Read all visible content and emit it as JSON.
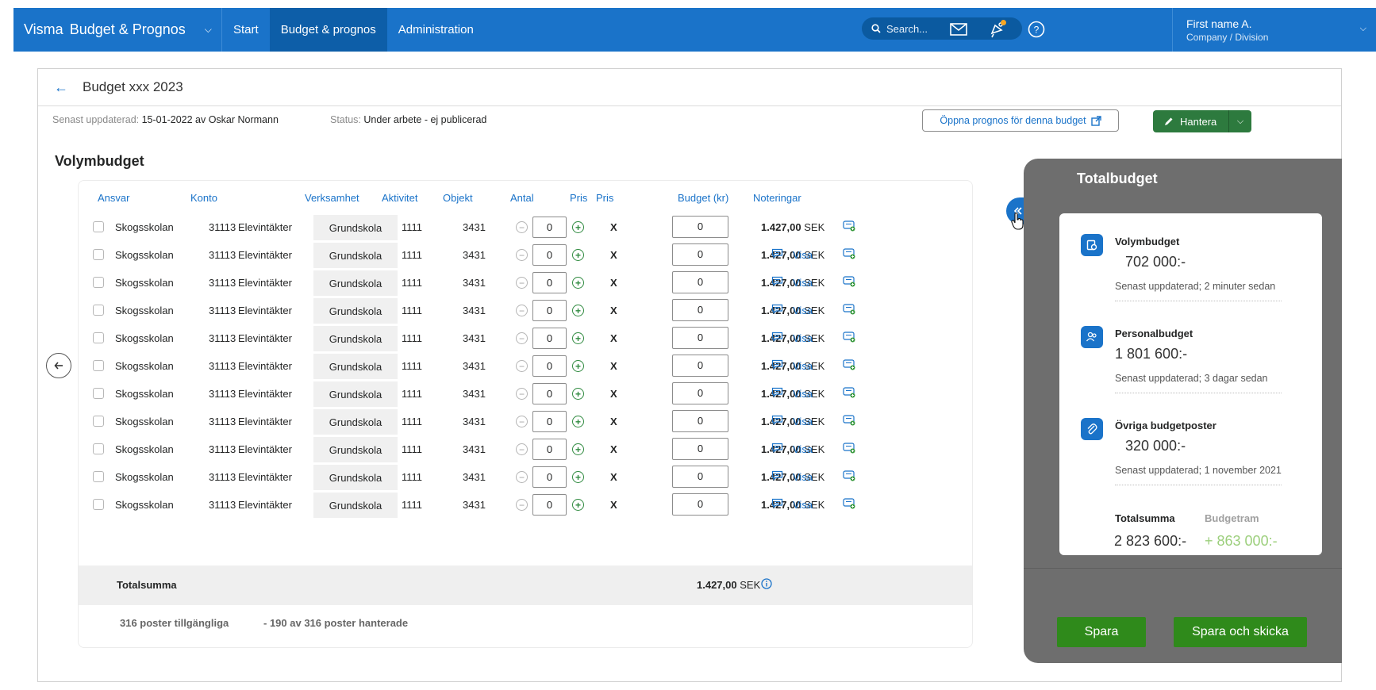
{
  "topbar": {
    "brand": "Visma",
    "product": "Budget & Prognos",
    "nav": [
      "Start",
      "Budget & prognos",
      "Administration"
    ],
    "search_placeholder": "Search...",
    "user_name": "First name A.",
    "user_company": "Company / Division"
  },
  "page": {
    "title": "Budget xxx 2023",
    "updated_label": "Senast uppdaterad:",
    "updated_value": "15-01-2022 av Oskar Normann",
    "status_label": "Status:",
    "status_value": "Under arbete - ej publicerad",
    "open_forecast_label": "Öppna  prognos för denna budget",
    "manage_label": "Hantera",
    "section_title": "Volymbudget"
  },
  "table": {
    "headers": {
      "ansvar": "Ansvar",
      "konto": "Konto",
      "verksamhet": "Verksamhet",
      "aktivitet": "Aktivitet",
      "objekt": "Objekt",
      "antal": "Antal",
      "pris1": "Pris",
      "pris2": "Pris",
      "budget": "Budget (kr)",
      "noteringar": "Noteringar"
    },
    "x_mark": "X",
    "visa_label": "Visa",
    "rows": [
      {
        "ansvar": "Skogsskolan",
        "konto_nr": "31113",
        "konto_namn": "Elevintäkter",
        "verksamhet": "Grundskola",
        "aktivitet": "1111",
        "objekt": "3431",
        "antal": "0",
        "pris": "0",
        "budget": "1.427,00",
        "valuta": "SEK",
        "visa": ""
      },
      {
        "ansvar": "Skogsskolan",
        "konto_nr": "31113",
        "konto_namn": "Elevintäkter",
        "verksamhet": "Grundskola",
        "aktivitet": "1111",
        "objekt": "3431",
        "antal": "0",
        "pris": "0",
        "budget": "1.427,00",
        "valuta": "SEK",
        "visa": "Visa"
      },
      {
        "ansvar": "Skogsskolan",
        "konto_nr": "31113",
        "konto_namn": "Elevintäkter",
        "verksamhet": "Grundskola",
        "aktivitet": "1111",
        "objekt": "3431",
        "antal": "0",
        "pris": "0",
        "budget": "1.427,00",
        "valuta": "SEK",
        "visa": "Visa"
      },
      {
        "ansvar": "Skogsskolan",
        "konto_nr": "31113",
        "konto_namn": "Elevintäkter",
        "verksamhet": "Grundskola",
        "aktivitet": "1111",
        "objekt": "3431",
        "antal": "0",
        "pris": "0",
        "budget": "1.427,00",
        "valuta": "SEK",
        "visa": "Visa"
      },
      {
        "ansvar": "Skogsskolan",
        "konto_nr": "31113",
        "konto_namn": "Elevintäkter",
        "verksamhet": "Grundskola",
        "aktivitet": "1111",
        "objekt": "3431",
        "antal": "0",
        "pris": "0",
        "budget": "1.427,00",
        "valuta": "SEK",
        "visa": "Visa"
      },
      {
        "ansvar": "Skogsskolan",
        "konto_nr": "31113",
        "konto_namn": "Elevintäkter",
        "verksamhet": "Grundskola",
        "aktivitet": "1111",
        "objekt": "3431",
        "antal": "0",
        "pris": "0",
        "budget": "1.427,00",
        "valuta": "SEK",
        "visa": "Visa"
      },
      {
        "ansvar": "Skogsskolan",
        "konto_nr": "31113",
        "konto_namn": "Elevintäkter",
        "verksamhet": "Grundskola",
        "aktivitet": "1111",
        "objekt": "3431",
        "antal": "0",
        "pris": "0",
        "budget": "1.427,00",
        "valuta": "SEK",
        "visa": "Visa"
      },
      {
        "ansvar": "Skogsskolan",
        "konto_nr": "31113",
        "konto_namn": "Elevintäkter",
        "verksamhet": "Grundskola",
        "aktivitet": "1111",
        "objekt": "3431",
        "antal": "0",
        "pris": "0",
        "budget": "1.427,00",
        "valuta": "SEK",
        "visa": "Visa"
      },
      {
        "ansvar": "Skogsskolan",
        "konto_nr": "31113",
        "konto_namn": "Elevintäkter",
        "verksamhet": "Grundskola",
        "aktivitet": "1111",
        "objekt": "3431",
        "antal": "0",
        "pris": "0",
        "budget": "1.427,00",
        "valuta": "SEK",
        "visa": "Visa"
      },
      {
        "ansvar": "Skogsskolan",
        "konto_nr": "31113",
        "konto_namn": "Elevintäkter",
        "verksamhet": "Grundskola",
        "aktivitet": "1111",
        "objekt": "3431",
        "antal": "0",
        "pris": "0",
        "budget": "1.427,00",
        "valuta": "SEK",
        "visa": "Visa"
      },
      {
        "ansvar": "Skogsskolan",
        "konto_nr": "31113",
        "konto_namn": "Elevintäkter",
        "verksamhet": "Grundskola",
        "aktivitet": "1111",
        "objekt": "3431",
        "antal": "0",
        "pris": "0",
        "budget": "1.427,00",
        "valuta": "SEK",
        "visa": "Visa"
      }
    ],
    "total_label": "Totalsumma",
    "total_value": "1.427,00",
    "total_currency": "SEK",
    "available": "316 poster tillgängliga",
    "handled": "- 190 av 316 poster hanterade"
  },
  "panel": {
    "title": "Totalbudget",
    "sections": [
      {
        "name": "Volymbudget",
        "value": "702 000:-",
        "updated": "Senast uppdaterad; 2 minuter sedan"
      },
      {
        "name": "Personalbudget",
        "value": "1 801 600:-",
        "updated": "Senast uppdaterad; 3 dagar sedan"
      },
      {
        "name": "Övriga budgetposter",
        "value": "320 000:-",
        "updated": "Senast uppdaterad; 1 november 2021"
      }
    ],
    "total_label": "Totalsumma",
    "total_value": "2 823 600:-",
    "frame_label": "Budgetram",
    "frame_value": "+ 863 000:-",
    "save_label": "Spara",
    "save_send_label": "Spara och skicka"
  },
  "colors": {
    "brand_blue": "#1a73c9",
    "active_nav": "#0d5ea8",
    "primary_green": "#2f8a1b",
    "positive_green": "#9ccf7c",
    "panel_grey": "#6e6e6e"
  }
}
